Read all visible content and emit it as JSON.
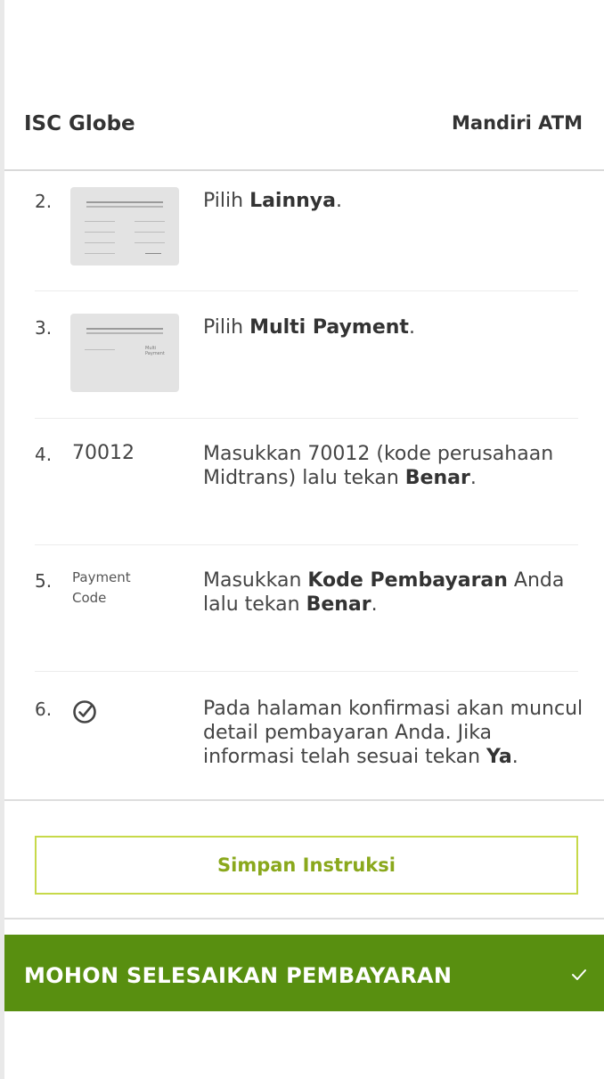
{
  "header": {
    "merchant": "ISC Globe",
    "payment_method": "Mandiri ATM"
  },
  "steps": [
    {
      "number": "2.",
      "thumb": "screen-menu-thumbnail",
      "text_parts": [
        "Pilih ",
        "Lainnya",
        "."
      ]
    },
    {
      "number": "3.",
      "thumb": "screen-multipayment-thumbnail",
      "thumb_text": "Multi Payment",
      "text_parts": [
        "Pilih ",
        "Multi Payment",
        "."
      ]
    },
    {
      "number": "4.",
      "code": "70012",
      "text_parts": [
        "Masukkan 70012 (kode perusahaan Midtrans) lalu tekan ",
        "Benar",
        "."
      ]
    },
    {
      "number": "5.",
      "label_line1": "Payment",
      "label_line2": "Code",
      "text_parts": [
        "Masukkan ",
        "Kode Pembayaran",
        " Anda lalu tekan ",
        "Benar",
        "."
      ]
    },
    {
      "number": "6.",
      "icon": "check-circle-icon",
      "text_parts": [
        "Pada halaman konfirmasi akan muncul detail pembayaran Anda. Jika informasi telah sesuai tekan ",
        "Ya",
        "."
      ]
    }
  ],
  "save_button": {
    "label": "Simpan Instruksi"
  },
  "banner": {
    "label": "MOHON SELESAIKAN PEMBAYARAN",
    "icon": "checkmark-icon",
    "color": "#588f10"
  },
  "colors": {
    "accent": "#8aa81c",
    "button_border": "#c7d94a"
  }
}
